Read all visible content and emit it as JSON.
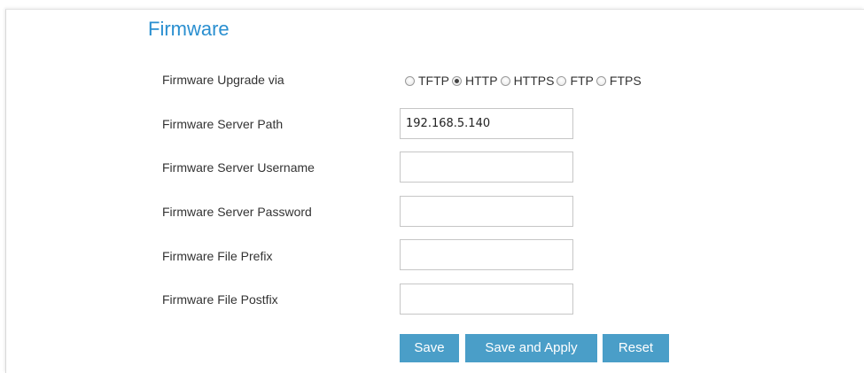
{
  "section": {
    "title": "Firmware"
  },
  "form": {
    "upgrade_via": {
      "label": "Firmware Upgrade via",
      "options": [
        "TFTP",
        "HTTP",
        "HTTPS",
        "FTP",
        "FTPS"
      ],
      "selected": "HTTP"
    },
    "server_path": {
      "label": "Firmware Server Path",
      "value": "192.168.5.140",
      "placeholder": ""
    },
    "server_username": {
      "label": "Firmware Server Username",
      "value": "",
      "placeholder": ""
    },
    "server_password": {
      "label": "Firmware Server Password",
      "value": "",
      "placeholder": ""
    },
    "file_prefix": {
      "label": "Firmware File Prefix",
      "value": "",
      "placeholder": ""
    },
    "file_postfix": {
      "label": "Firmware File Postfix",
      "value": "",
      "placeholder": ""
    }
  },
  "actions": {
    "save_label": "Save",
    "save_apply_label": "Save and Apply",
    "reset_label": "Reset"
  },
  "colors": {
    "title": "#2a8fd0",
    "button": "#4a9ec8",
    "label_text": "#333333"
  }
}
